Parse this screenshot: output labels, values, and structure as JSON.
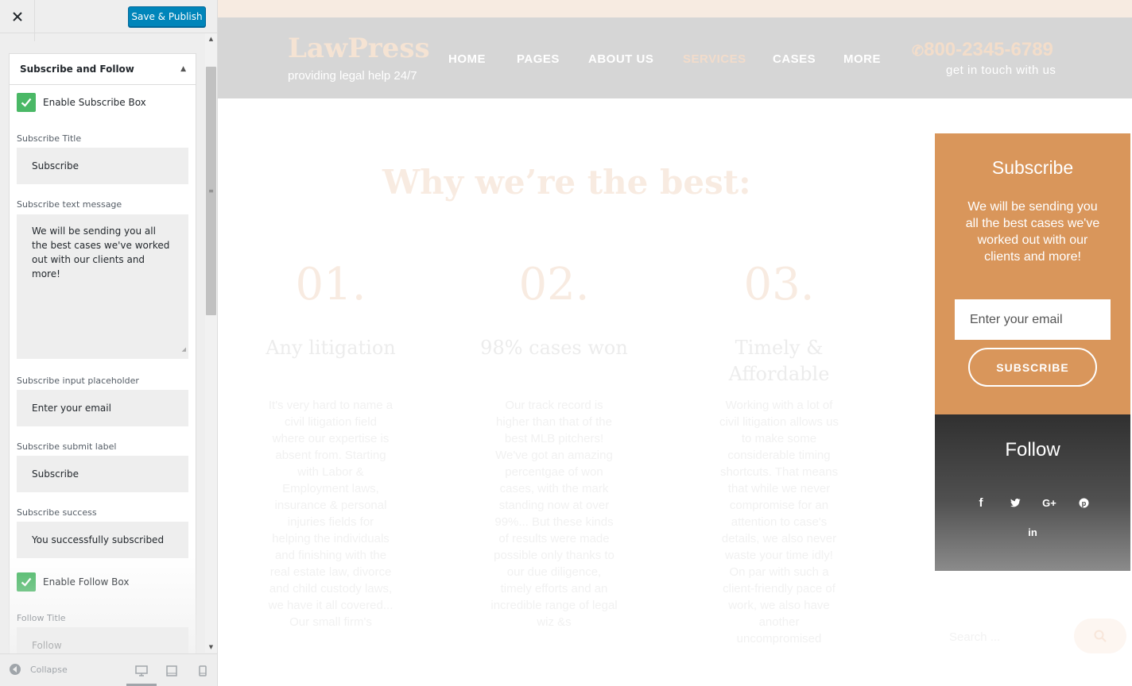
{
  "customizer": {
    "close_icon": "close-icon",
    "save_label": "Save & Publish",
    "section_title": "Subscribe and Follow",
    "enable_subscribe_label": "Enable Subscribe Box",
    "enable_subscribe_checked": true,
    "fields": {
      "subscribe_title": {
        "label": "Subscribe Title",
        "value": "Subscribe"
      },
      "subscribe_text": {
        "label": "Subscribe text message",
        "value": "We will be sending you all the best cases we've worked out with our clients and more!"
      },
      "subscribe_placeholder": {
        "label": "Subscribe input placeholder",
        "value": "Enter your email"
      },
      "subscribe_submit": {
        "label": "Subscribe submit label",
        "value": "Subscribe"
      },
      "subscribe_success": {
        "label": "Subscribe success",
        "value": "You successfully subscribed"
      },
      "follow_title": {
        "label": "Follow Title",
        "value": "Follow"
      }
    },
    "enable_follow_label": "Enable Follow Box",
    "enable_follow_checked": true,
    "collapse_label": "Collapse",
    "accent_color": "#0085ba",
    "check_color": "#4ab866"
  },
  "preview": {
    "logo": "LawPress",
    "tagline": "providing legal help 24/7",
    "nav": [
      "HOME",
      "PAGES",
      "ABOUT US",
      "SERVICES",
      "CASES",
      "MORE"
    ],
    "nav_active": "SERVICES",
    "phone": "800-2345-6789",
    "contact": "get in touch with us",
    "why_title": "Why we’re the best:",
    "columns": [
      {
        "num": "01.",
        "title": "Any litigation",
        "body": "It's very hard to name a civil litigation field where our expertise is absent from. Starting with Labor & Employment laws, insurance & personal injuries fields for helping the individuals and finishing with the real estate law, divorce and child custody laws, we have it all covered... Our small firm's"
      },
      {
        "num": "02.",
        "title": "98% cases won",
        "body": "Our track record is higher than that of the best MLB pitchers! We've got an amazing percentgae of won cases, with the mark standing now at over 99%... But these kinds of results were made possible only thanks to our due diligence, timely efforts and an incredible range of legal wiz &s"
      },
      {
        "num": "03.",
        "title": "Timely & Affordable",
        "body": "Working with a lot of civil litigation allows us to make some considerable timing shortcuts. That means that while we never compromise for an attention to case's details, we also never waste your time idly! On par with such a client-friendly pace of work, we also have another uncompromised"
      }
    ],
    "subscribe": {
      "title": "Subscribe",
      "text": "We will be sending you all the best cases we've worked out with our clients and more!",
      "placeholder": "Enter your email",
      "button": "SUBSCRIBE",
      "bg_color": "#d9965b"
    },
    "follow": {
      "title": "Follow",
      "icons": [
        "facebook-icon",
        "twitter-icon",
        "google-plus-icon",
        "pinterest-icon",
        "linkedin-icon"
      ]
    },
    "search_placeholder": "Search ..."
  }
}
